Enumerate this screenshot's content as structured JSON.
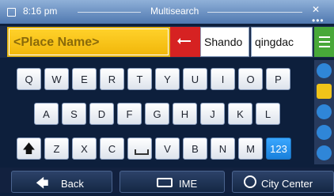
{
  "status_bar": {
    "time": "8:16 pm",
    "title": "Multisearch",
    "right_indicator": "✕ •••"
  },
  "search": {
    "placeholder": "<Place Name>"
  },
  "suggestions": [
    "Shando",
    "qingdac"
  ],
  "keyboard": {
    "row1": [
      "Q",
      "W",
      "E",
      "R",
      "T",
      "Y",
      "U",
      "I",
      "O",
      "P"
    ],
    "row2": [
      "A",
      "S",
      "D",
      "F",
      "G",
      "H",
      "J",
      "K",
      "L"
    ],
    "row3": [
      "Z",
      "X",
      "C",
      "V",
      "B",
      "N",
      "M"
    ],
    "numbers_label": "123"
  },
  "bottom_bar": {
    "back_label": "Back",
    "ime_label": "IME",
    "city_center_label": "City Center"
  },
  "colors": {
    "accent_yellow": "#f3be12",
    "backspace_red": "#d62222",
    "menu_green": "#48a839",
    "number_key_blue": "#1d88e6"
  }
}
